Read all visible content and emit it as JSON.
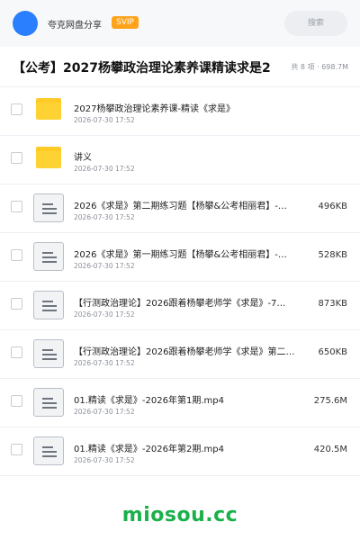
{
  "header": {
    "app_name": "夸克网盘分享",
    "badge": "SVIP",
    "search_placeholder": "搜索"
  },
  "share": {
    "title": "【公考】2027杨攀政治理论素养课精读求是2",
    "summary": "共 8 项 · 698.7M"
  },
  "files": [
    {
      "kind": "folder",
      "name": "2027杨攀政治理论素养课-精读《求是》",
      "date": "2026-07-30 17:52",
      "size": ""
    },
    {
      "kind": "folder",
      "name": "讲义",
      "date": "2026-07-30 17:52",
      "size": ""
    },
    {
      "kind": "file",
      "name": "2026《求是》第二期练习题【杨攀&公考相丽君】-…",
      "date": "2026-07-30 17:52",
      "size": "496KB"
    },
    {
      "kind": "file",
      "name": "2026《求是》第一期练习题【杨攀&公考相丽君】-…",
      "date": "2026-07-30 17:52",
      "size": "528KB"
    },
    {
      "kind": "file",
      "name": "【行测政治理论】2026跟着杨攀老师学《求是》-7…",
      "date": "2026-07-30 17:52",
      "size": "873KB"
    },
    {
      "kind": "file",
      "name": "【行测政治理论】2026跟着杨攀老师学《求是》第二…",
      "date": "2026-07-30 17:52",
      "size": "650KB"
    },
    {
      "kind": "file",
      "name": "01.精读《求是》-2026年第1期.mp4",
      "date": "2026-07-30 17:52",
      "size": "275.6M"
    },
    {
      "kind": "file",
      "name": "01.精读《求是》-2026年第2期.mp4",
      "date": "2026-07-30 17:52",
      "size": "420.5M"
    }
  ],
  "icons": {
    "folder": "folder-icon",
    "file": "document-icon"
  },
  "colors": {
    "avatar": "#2a7fff",
    "badge": "#ffa31a",
    "folder": "#ffd233",
    "watermark": "#1ab04a"
  },
  "watermark": "miosou.cc"
}
